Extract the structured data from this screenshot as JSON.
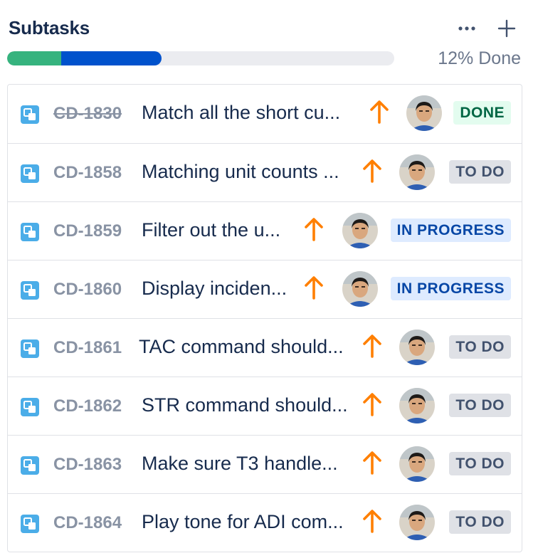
{
  "header": {
    "title": "Subtasks",
    "more_icon": "more-horizontal-icon",
    "add_icon": "plus-icon"
  },
  "progress": {
    "label": "12% Done",
    "done_fraction": 0.14,
    "in_progress_fraction": 0.26,
    "colors": {
      "done": "#36b37e",
      "in_progress": "#0052cc",
      "track": "#ebecf0"
    }
  },
  "status_styles": {
    "DONE": {
      "bg": "#e3fcef",
      "fg": "#006644"
    },
    "TO DO": {
      "bg": "#dfe1e6",
      "fg": "#42526e"
    },
    "IN PROGRESS": {
      "bg": "#deebff",
      "fg": "#0747a6"
    }
  },
  "subtasks": [
    {
      "key": "CD-1830",
      "summary": "Match all the short cu...",
      "status": "DONE",
      "resolved": true,
      "priority_icon": "priority-high-arrow-icon",
      "avatar_icon": "user-avatar-icon"
    },
    {
      "key": "CD-1858",
      "summary": "Matching unit counts ...",
      "status": "TO DO",
      "resolved": false,
      "priority_icon": "priority-high-arrow-icon",
      "avatar_icon": "user-avatar-icon"
    },
    {
      "key": "CD-1859",
      "summary": "Filter out the u...",
      "status": "IN PROGRESS",
      "resolved": false,
      "priority_icon": "priority-high-arrow-icon",
      "avatar_icon": "user-avatar-icon"
    },
    {
      "key": "CD-1860",
      "summary": "Display inciden...",
      "status": "IN PROGRESS",
      "resolved": false,
      "priority_icon": "priority-high-arrow-icon",
      "avatar_icon": "user-avatar-icon"
    },
    {
      "key": "CD-1861",
      "summary": "TAC command should...",
      "status": "TO DO",
      "resolved": false,
      "priority_icon": "priority-high-arrow-icon",
      "avatar_icon": "user-avatar-icon"
    },
    {
      "key": "CD-1862",
      "summary": "STR command should...",
      "status": "TO DO",
      "resolved": false,
      "priority_icon": "priority-high-arrow-icon",
      "avatar_icon": "user-avatar-icon"
    },
    {
      "key": "CD-1863",
      "summary": "Make sure T3 handle...",
      "status": "TO DO",
      "resolved": false,
      "priority_icon": "priority-high-arrow-icon",
      "avatar_icon": "user-avatar-icon"
    },
    {
      "key": "CD-1864",
      "summary": "Play tone for ADI com...",
      "status": "TO DO",
      "resolved": false,
      "priority_icon": "priority-high-arrow-icon",
      "avatar_icon": "user-avatar-icon"
    }
  ]
}
